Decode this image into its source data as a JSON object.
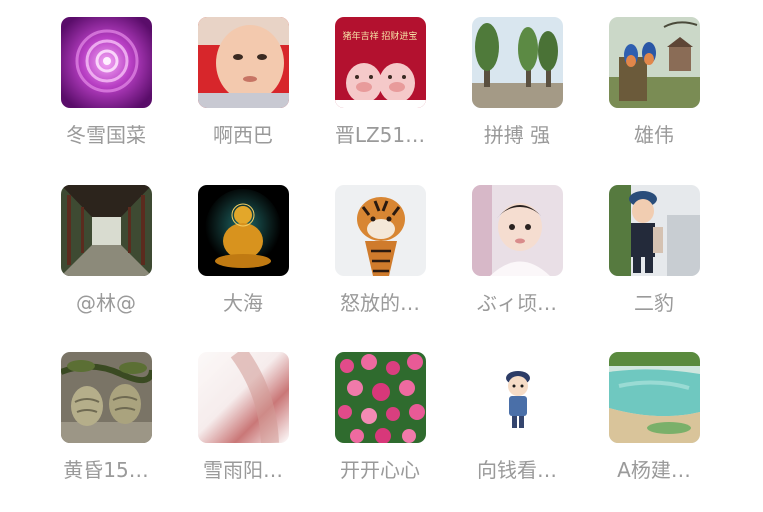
{
  "contacts": [
    {
      "name": "冬雪国菜",
      "avatar_icon": "purple-rose-icon"
    },
    {
      "name": "啊西巴",
      "avatar_icon": "baby-face-icon"
    },
    {
      "name": "晋LZ51…",
      "avatar_icon": "cartoon-pigs-icon",
      "avatar_text": "猪年吉祥 招财进宝"
    },
    {
      "name": "拼搏   强",
      "avatar_icon": "tree-road-icon"
    },
    {
      "name": "雄伟",
      "avatar_icon": "bluebirds-icon"
    },
    {
      "name": "@林@",
      "avatar_icon": "corridor-icon"
    },
    {
      "name": "大海",
      "avatar_icon": "golden-buddha-icon"
    },
    {
      "name": "怒放的…",
      "avatar_icon": "tiger-icon"
    },
    {
      "name": "ぶィ顷…",
      "avatar_icon": "baby-girl-icon"
    },
    {
      "name": "二豹",
      "avatar_icon": "boy-with-hat-icon"
    },
    {
      "name": "黄昏15…",
      "avatar_icon": "walnuts-icon"
    },
    {
      "name": "雪雨阳…",
      "avatar_icon": "blurred-light-icon"
    },
    {
      "name": "开开心心",
      "avatar_icon": "pink-flowers-icon"
    },
    {
      "name": "向钱看…",
      "avatar_icon": "chibi-figure-icon"
    },
    {
      "name": "A杨建…",
      "avatar_icon": "lake-landscape-icon"
    }
  ]
}
